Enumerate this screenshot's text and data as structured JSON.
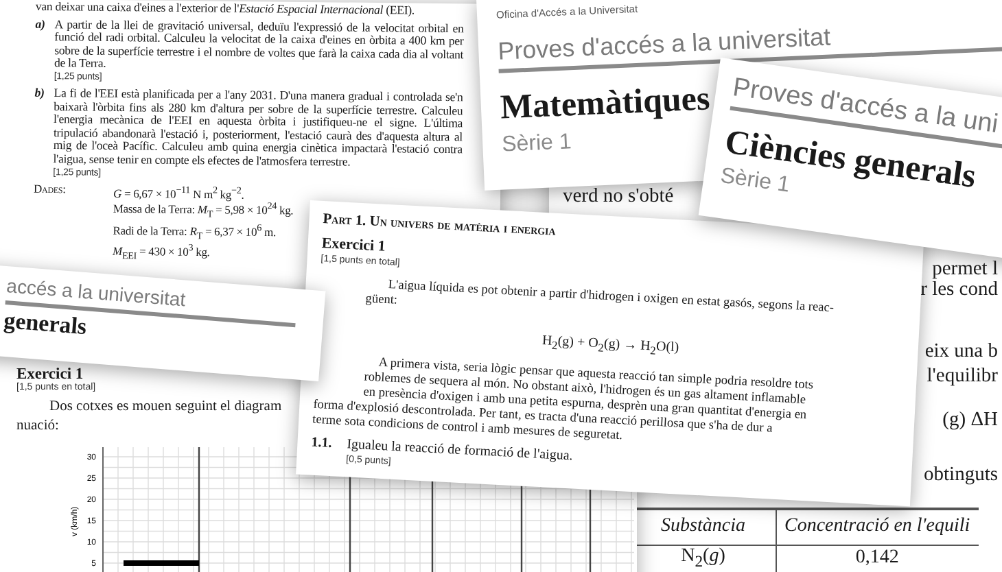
{
  "physics_sheet": {
    "intro": "van deixar una caixa d'eines a l'exterior de l'*Estació Espacial Internacional* (EEI).",
    "questions": [
      {
        "label": "a)",
        "text": "A partir de la llei de gravitació universal, deduïu l'expressió de la velocitat orbital en funció del radi orbital. Calculeu la velocitat de la caixa d'eines en òrbita a 400 km per sobre de la superfície terrestre i el nombre de voltes que farà la caixa cada dia al voltant de la Terra.",
        "points": "[1,25 punts]"
      },
      {
        "label": "b)",
        "text": "La fi de l'EEI està planificada per a l'any 2031. D'una manera gradual i controlada se'n baixarà l'òrbita fins als 280 km d'altura per sobre de la superfície terrestre. Calculeu l'energia mecànica de l'EEI en aquesta òrbita i justifiqueu-ne el signe. L'última tripulació abandonarà l'estació i, posteriorment, l'estació caurà des d'aquesta altura al mig de l'oceà Pacífic. Calculeu amb quina energia cinètica impactarà l'estació contra l'aigua, sense tenir en compte els efectes de l'atmosfera terrestre.",
        "points": "[1,25 punts]"
      }
    ],
    "data": {
      "label": "Dades:",
      "lines": [
        "*G* = 6,67 × 10$^{−11}$ N m$^{2}$ kg$^{−2}$.",
        "Massa de la Terra: *M*$_{T}$ = 5,98 × 10$^{24}$ kg.",
        "Radi de la Terra: *R*$_{T}$ = 6,37 × 10$^{6}$ m.",
        "*M*$_{EEI}$ = 430 × 10$^{3}$ kg."
      ]
    }
  },
  "math_sheet": {
    "office": "Oficina d'Accés a la Universitat",
    "header": "Proves d'accés a la universitat",
    "subject": "Matemàtiques",
    "series": "Sèrie 1"
  },
  "right_sheet": {
    "fragments": [
      "verd no s'obté",
      "permet l",
      "r les cond",
      "eix una b",
      "l'equilibr",
      "(g)   ΔH",
      "obtinguts"
    ],
    "table": {
      "columns": [
        "Substància",
        "Concentració en l'equili"
      ],
      "rows": [
        [
          "N$_{2}$(*g*)",
          "0,142"
        ]
      ]
    }
  },
  "graph_sheet": {
    "exercise": "Exercici 1",
    "points": "[1,5 punts en total]",
    "text_lines": [
      "Dos cotxes es mouen seguint el diagram",
      "nuació:"
    ],
    "graph": {
      "y_axis_label": "v (km/h)",
      "y_ticks": [
        "30",
        "25",
        "20",
        "15",
        "10",
        "5"
      ]
    }
  },
  "chem_sheet": {
    "part": "Part 1. Un univers de matèria i energia",
    "exercise": "Exercici 1",
    "points": "[1,5 punts en total]",
    "intro_lines": [
      "L'aigua líquida es pot obtenir a partir d'hidrogen i oxigen en estat gasós, segons la reac-",
      "güent:"
    ],
    "equation": "H$_{2}$(g) + O$_{2}$(g) → H$_{2}$O(l)",
    "body_lines": [
      "A primera vista, seria lògic pensar que aquesta reacció tan simple podria resoldre tots",
      "roblemes de sequera al món. No obstant això, l'hidrogen és un gas altament inflamable",
      "en presència d'oxigen i amb una petita espurna, desprèn una gran quantitat d'energia en",
      "forma d'explosió descontrolada. Per tant, es tracta d'una reacció perillosa que s'ha de dur a",
      "terme sota condicions de control i amb mesures de seguretat."
    ],
    "question": {
      "number": "1.1.",
      "text": "Igualeu la reacció de formació de l'aigua.",
      "points": "[0,5 punts]"
    }
  },
  "strip_sheet": {
    "header": "accés a la universitat",
    "subject": "generals"
  },
  "science_sheet": {
    "header": "Proves d'accés a la uni",
    "subject": "Ciències generals",
    "series": "Sèrie 1"
  }
}
